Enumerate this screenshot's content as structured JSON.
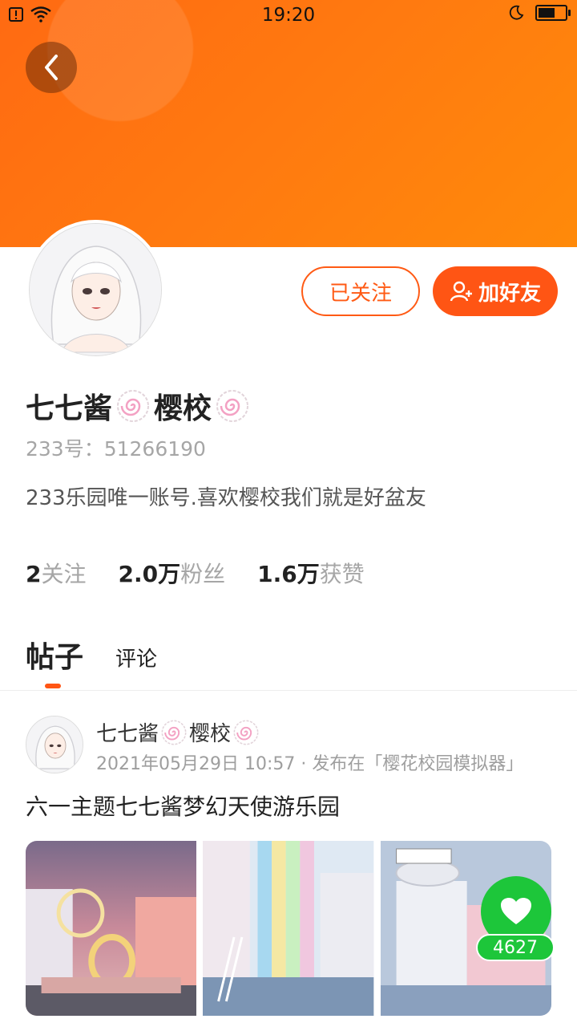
{
  "status_bar": {
    "time": "19:20"
  },
  "profile": {
    "name_part1": "七七酱",
    "name_part2": "樱校",
    "uid": "233号：51266190",
    "bio": "233乐园唯一账号.喜欢樱校我们就是好盆友"
  },
  "actions": {
    "followed_label": "已关注",
    "add_friend_label": "加好友"
  },
  "stats": [
    {
      "num": "2",
      "label": "关注"
    },
    {
      "num": "2.0万",
      "label": "粉丝"
    },
    {
      "num": "1.6万",
      "label": "获赞"
    }
  ],
  "tabs": {
    "posts": "帖子",
    "comments": "评论"
  },
  "post": {
    "author_part1": "七七酱",
    "author_part2": "樱校",
    "meta": "2021年05月29日 10:57 · 发布在「樱花校园模拟器」",
    "title": "六一主题七七酱梦幻天使游乐园",
    "like_count": "4627"
  },
  "colors": {
    "accent": "#ff5514",
    "like_green": "#1dc63a",
    "banner": "#ff7a10"
  }
}
